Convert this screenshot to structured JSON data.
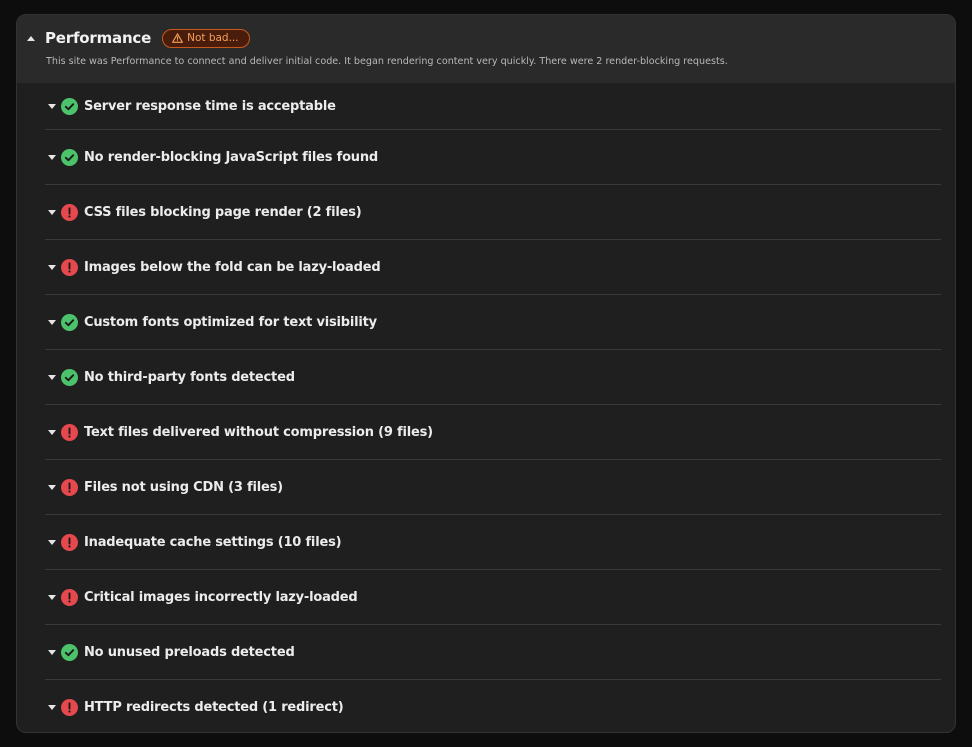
{
  "section": {
    "title": "Performance",
    "badge": "Not bad...",
    "description": "This site was Performance to connect and deliver initial code. It began rendering content very quickly. There were 2 render-blocking requests."
  },
  "colors": {
    "pass": "#4cc36a",
    "fail": "#e5484d",
    "badge_text": "#f2a15a",
    "badge_border": "#c65a1e"
  },
  "items": [
    {
      "label": "Server response time is acceptable",
      "status": "pass"
    },
    {
      "label": "No render-blocking JavaScript files found",
      "status": "pass"
    },
    {
      "label": "CSS files blocking page render (2 files)",
      "status": "fail"
    },
    {
      "label": "Images below the fold can be lazy-loaded",
      "status": "fail"
    },
    {
      "label": "Custom fonts optimized for text visibility",
      "status": "pass"
    },
    {
      "label": "No third-party fonts detected",
      "status": "pass"
    },
    {
      "label": "Text files delivered without compression (9 files)",
      "status": "fail"
    },
    {
      "label": "Files not using CDN (3 files)",
      "status": "fail"
    },
    {
      "label": "Inadequate cache settings (10 files)",
      "status": "fail"
    },
    {
      "label": "Critical images incorrectly lazy-loaded",
      "status": "fail"
    },
    {
      "label": "No unused preloads detected",
      "status": "pass"
    },
    {
      "label": "HTTP redirects detected (1 redirect)",
      "status": "fail"
    }
  ]
}
